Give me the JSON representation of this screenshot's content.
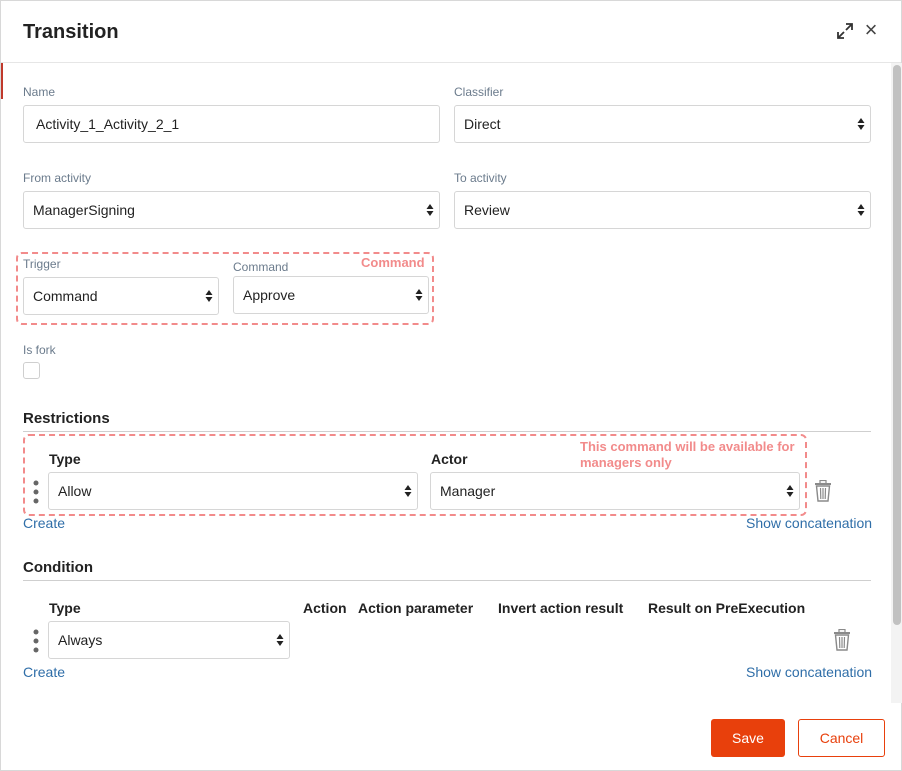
{
  "dialog": {
    "title": "Transition",
    "expand_icon": "expand-arrows-icon",
    "close_icon": "close-icon",
    "close_glyph": "×"
  },
  "fields": {
    "name_label": "Name",
    "name_value": "Activity_1_Activity_2_1",
    "classifier_label": "Classifier",
    "classifier_value": "Direct",
    "from_label": "From activity",
    "from_value": "ManagerSigning",
    "to_label": "To activity",
    "to_value": "Review",
    "trigger_label": "Trigger",
    "trigger_value": "Command",
    "command_label": "Command",
    "command_value": "Approve",
    "is_fork_label": "Is fork",
    "is_fork_checked": false
  },
  "annotations": {
    "command_note": "Command",
    "restriction_note_line1": "This command will be available for",
    "restriction_note_line2": "managers only",
    "color": "#f28b8b"
  },
  "restrictions": {
    "title": "Restrictions",
    "type_header": "Type",
    "actor_header": "Actor",
    "row": {
      "type": "Allow",
      "actor": "Manager"
    },
    "create_link": "Create",
    "concat_link": "Show concatenation"
  },
  "condition": {
    "title": "Condition",
    "headers": [
      "Type",
      "Action",
      "Action parameter",
      "Invert action result",
      "Result on PreExecution"
    ],
    "row": {
      "type": "Always"
    },
    "create_link": "Create",
    "concat_link": "Show concatenation"
  },
  "buttons": {
    "save": "Save",
    "cancel": "Cancel",
    "accent": "#e8400c"
  }
}
